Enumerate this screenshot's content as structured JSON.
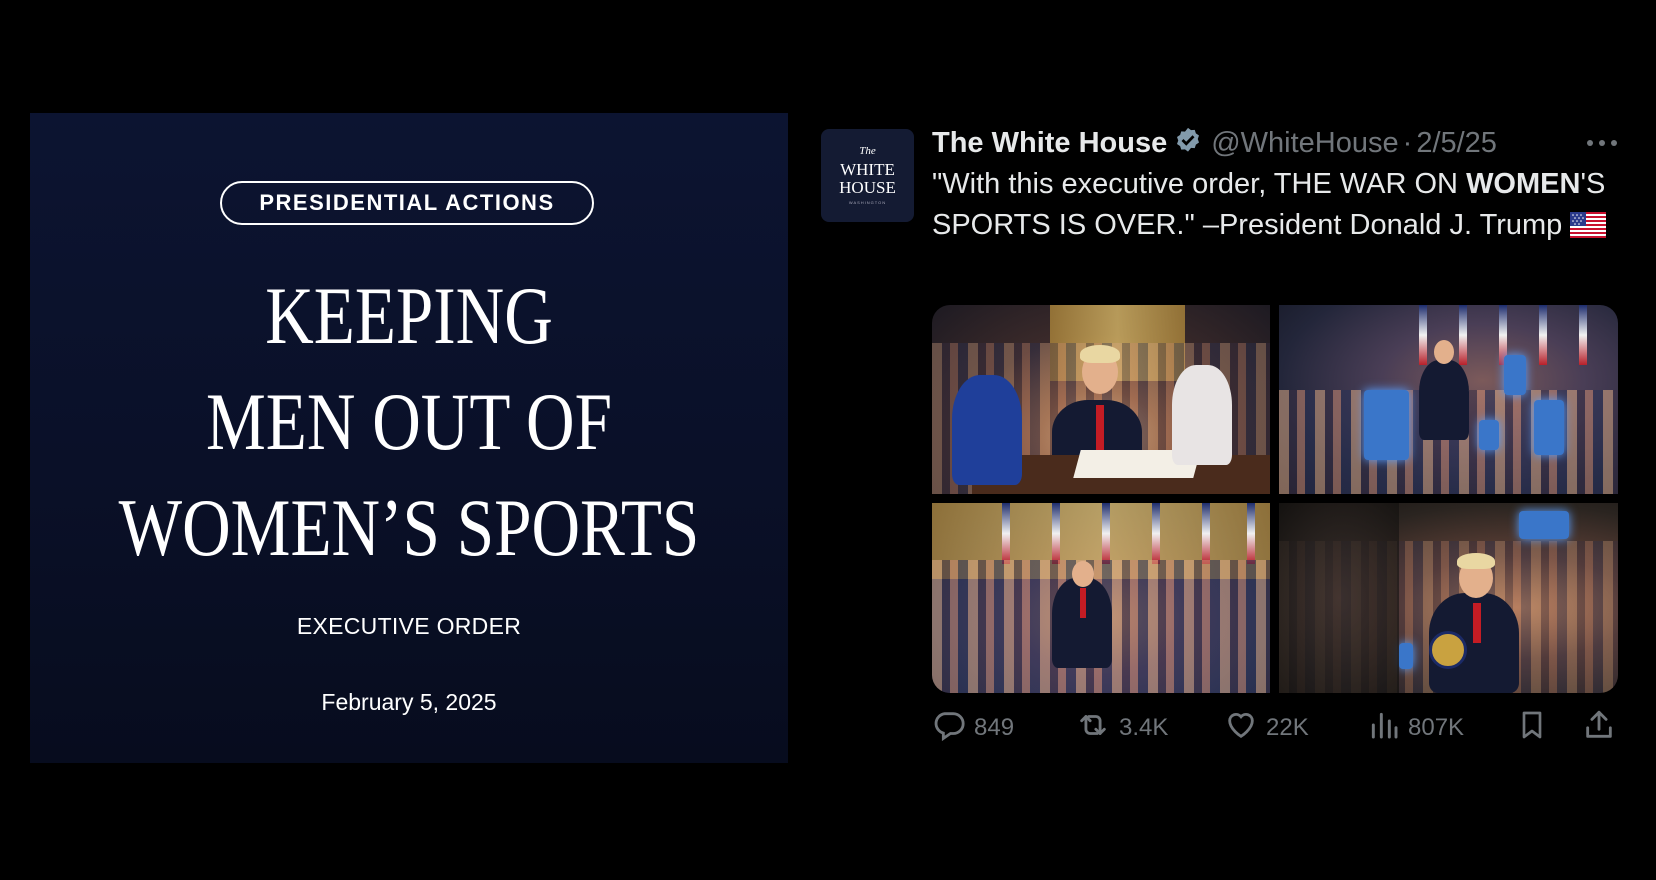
{
  "poster": {
    "category": "PRESIDENTIAL ACTIONS",
    "headline_lines": [
      "KEEPING",
      "MEN OUT OF",
      "WOMEN’S SPORTS"
    ],
    "subtitle": "EXECUTIVE ORDER",
    "date": "February 5, 2025",
    "background": "#0a1028"
  },
  "tweet": {
    "avatar": {
      "line1": "The",
      "line2": "WHITE",
      "line3": "HOUSE",
      "line4": "WASHINGTON",
      "icon": "white-house-logo"
    },
    "author": "The White House",
    "verified_icon": "verified-badge-icon",
    "handle": "@WhiteHouse",
    "separator": "·",
    "date": "2/5/25",
    "text": {
      "part1": "\"With this executive order, THE WAR ON ",
      "bold": "WOMEN",
      "part2": "'S SPORTS IS OVER.\" –President Donald J. Trump"
    },
    "photos_count": 4,
    "actions": {
      "replies": "849",
      "reposts": "3.4K",
      "likes": "22K",
      "views": "807K"
    },
    "colors": {
      "text": "#e7e9ea",
      "muted": "#71767b",
      "verified": "#829aab"
    }
  }
}
